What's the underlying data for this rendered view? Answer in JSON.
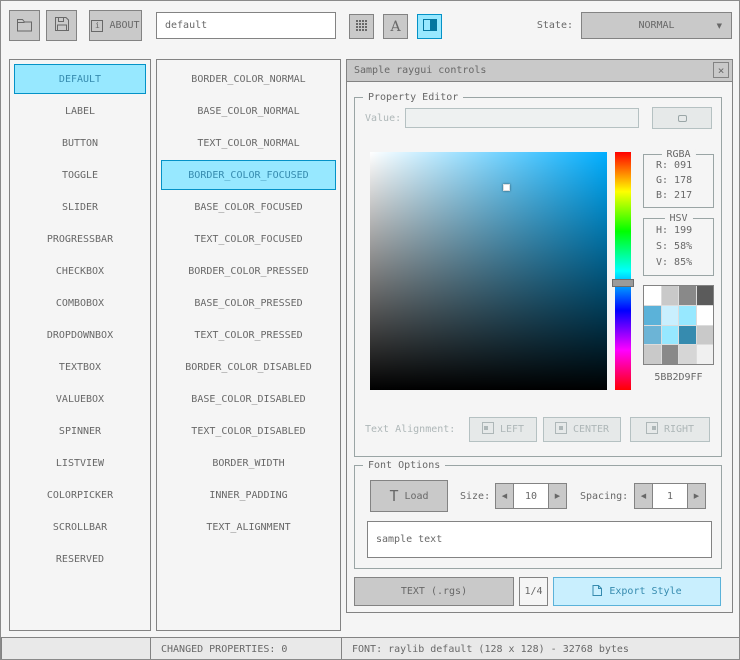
{
  "toolbar": {
    "about_label": "ABOUT",
    "style_name_value": "default",
    "font_button_glyph": "A",
    "state_label": "State:",
    "state_value": "NORMAL"
  },
  "controls_list": {
    "selected": "DEFAULT",
    "items": [
      "DEFAULT",
      "LABEL",
      "BUTTON",
      "TOGGLE",
      "SLIDER",
      "PROGRESSBAR",
      "CHECKBOX",
      "COMBOBOX",
      "DROPDOWNBOX",
      "TEXTBOX",
      "VALUEBOX",
      "SPINNER",
      "LISTVIEW",
      "COLORPICKER",
      "SCROLLBAR",
      "RESERVED"
    ]
  },
  "properties_list": {
    "selected": "BORDER_COLOR_FOCUSED",
    "items": [
      "BORDER_COLOR_NORMAL",
      "BASE_COLOR_NORMAL",
      "TEXT_COLOR_NORMAL",
      "BORDER_COLOR_FOCUSED",
      "BASE_COLOR_FOCUSED",
      "TEXT_COLOR_FOCUSED",
      "BORDER_COLOR_PRESSED",
      "BASE_COLOR_PRESSED",
      "TEXT_COLOR_PRESSED",
      "BORDER_COLOR_DISABLED",
      "BASE_COLOR_DISABLED",
      "TEXT_COLOR_DISABLED",
      "BORDER_WIDTH",
      "INNER_PADDING",
      "TEXT_ALIGNMENT"
    ]
  },
  "sample_window": {
    "title": "Sample raygui controls",
    "property_editor": {
      "title": "Property Editor",
      "value_label": "Value:",
      "value_text": "",
      "rgba_title": "RGBA",
      "rgba_lines": [
        "R: 091",
        "G: 178",
        "B: 217"
      ],
      "hsv_title": "HSV",
      "hsv_lines": [
        "H: 199",
        "S: 58%",
        "V: 85%"
      ],
      "hex_value": "5BB2D9FF",
      "selected_color": "#5BB2D9",
      "hue_deg": 199,
      "palette": [
        "#FFFFFF",
        "#C9C9C9",
        "#898989",
        "#5B5B5B",
        "#5BB2D9",
        "#C9EFFE",
        "#97E8FF",
        "#FFFFFF",
        "#6CB4D6",
        "#97E8FF",
        "#368BAF",
        "#C9C9C9",
        "#C9C9C9",
        "#898989",
        "#D6D6D6",
        "#F0F0F0"
      ],
      "text_alignment_label": "Text Alignment:",
      "align_buttons": [
        "LEFT",
        "CENTER",
        "RIGHT"
      ]
    },
    "font_options": {
      "title": "Font Options",
      "load_glyph": "T",
      "load_label": "Load",
      "size_label": "Size:",
      "size_value": "10",
      "spacing_label": "Spacing:",
      "spacing_value": "1",
      "sample_text": "sample text"
    },
    "export_row": {
      "format_button": "TEXT (.rgs)",
      "page_indicator": "1/4",
      "export_button": "Export Style"
    }
  },
  "status_bar": {
    "left": "",
    "changed_properties": "CHANGED PROPERTIES: 0",
    "font_info": "FONT: raylib default (128 x 128) - 32768 bytes"
  },
  "glyphs": {
    "dropdown_arrow": "▼",
    "close": "×",
    "left_arrow": "◀",
    "right_arrow": "▶"
  },
  "colors": {
    "accent_border": "#0492C7",
    "accent_fill": "#97E8FF",
    "focused_border": "#5BB2D9",
    "focused_fill": "#C9EFFE"
  }
}
